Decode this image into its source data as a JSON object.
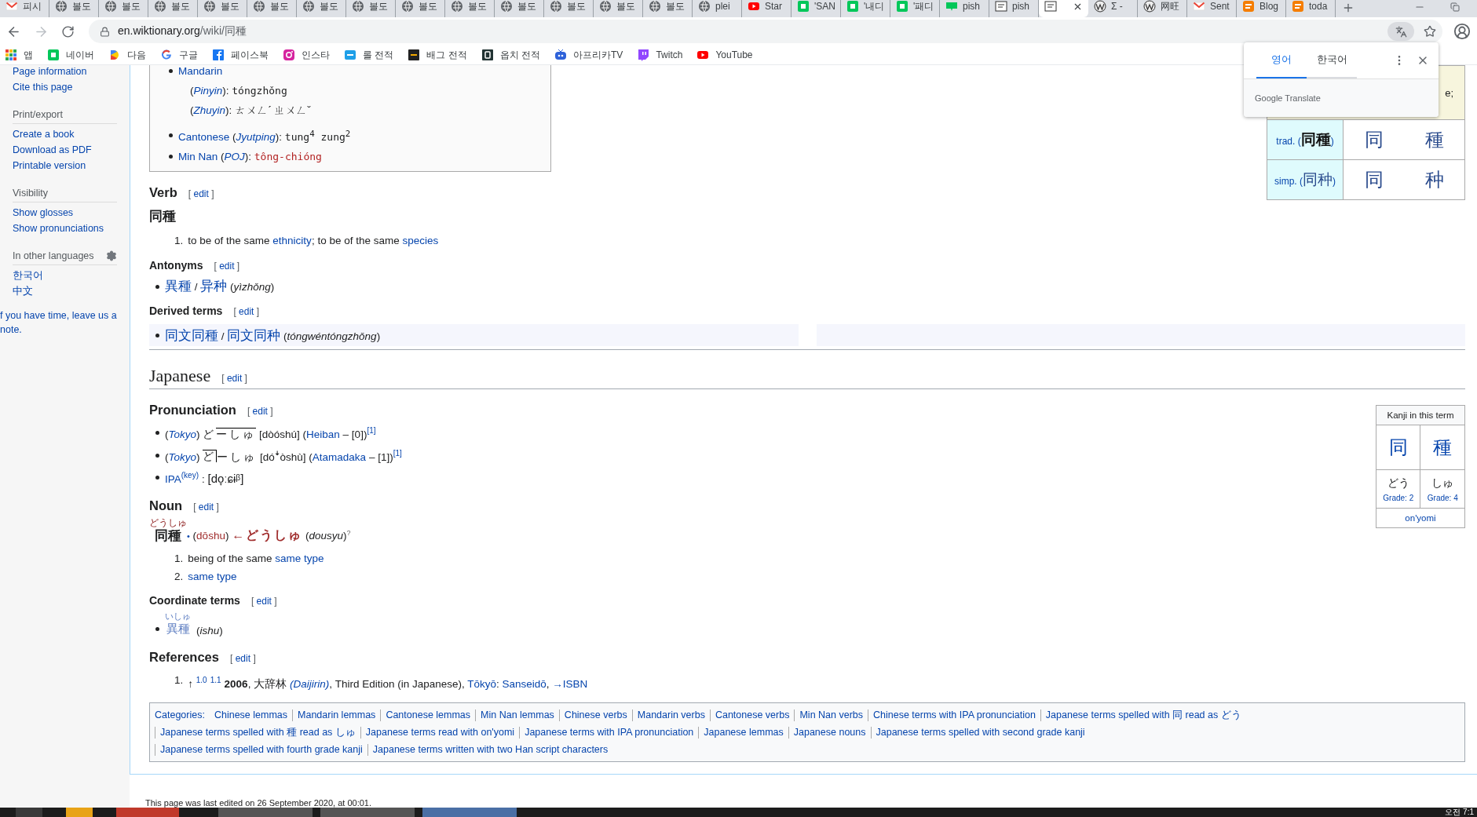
{
  "browser": {
    "tabs": [
      {
        "kind": "gmail",
        "title": "피시",
        "selected": false
      },
      {
        "kind": "globe",
        "title": "볼도",
        "selected": false
      },
      {
        "kind": "globe",
        "title": "볼도",
        "selected": false
      },
      {
        "kind": "globe",
        "title": "볼도",
        "selected": false
      },
      {
        "kind": "globe",
        "title": "볼도",
        "selected": false
      },
      {
        "kind": "globe",
        "title": "볼도",
        "selected": false
      },
      {
        "kind": "globe",
        "title": "볼도",
        "selected": false
      },
      {
        "kind": "globe",
        "title": "볼도",
        "selected": false
      },
      {
        "kind": "globe",
        "title": "볼도",
        "selected": false
      },
      {
        "kind": "globe",
        "title": "볼도",
        "selected": false
      },
      {
        "kind": "globe",
        "title": "볼도",
        "selected": false
      },
      {
        "kind": "globe",
        "title": "볼도",
        "selected": false
      },
      {
        "kind": "globe",
        "title": "볼도",
        "selected": false
      },
      {
        "kind": "globe",
        "title": "볼도",
        "selected": false
      },
      {
        "kind": "globe",
        "title": "plei",
        "selected": false
      },
      {
        "kind": "youtube",
        "title": "Star",
        "selected": false
      },
      {
        "kind": "naver",
        "title": "'SAN",
        "selected": false
      },
      {
        "kind": "naver",
        "title": "'내디",
        "selected": false
      },
      {
        "kind": "naver",
        "title": "'패디",
        "selected": false
      },
      {
        "kind": "blog",
        "title": "pish",
        "selected": false
      },
      {
        "kind": "wiki",
        "title": "pish",
        "selected": false
      },
      {
        "kind": "wiki",
        "selected": true
      },
      {
        "kind": "wikipedia",
        "title": "Σ -",
        "selected": false
      },
      {
        "kind": "wikipedia",
        "title": "网旺",
        "selected": false
      },
      {
        "kind": "gmail",
        "title": "Sent",
        "selected": false
      },
      {
        "kind": "blogger",
        "title": "Blog",
        "selected": false
      },
      {
        "kind": "blogger",
        "title": "toda",
        "selected": false
      }
    ],
    "address": {
      "host": "en.wiktionary.org",
      "path": "/wiki/同種"
    },
    "bookmarks": [
      {
        "kind": "apps",
        "label": "앱"
      },
      {
        "kind": "naver",
        "label": "네이버"
      },
      {
        "kind": "daum",
        "label": "다음"
      },
      {
        "kind": "google",
        "label": "구글"
      },
      {
        "kind": "facebook",
        "label": "페이스북"
      },
      {
        "kind": "instagram",
        "label": "인스타"
      },
      {
        "kind": "opgg",
        "label": "롤 전적"
      },
      {
        "kind": "pubg",
        "label": "배그 전적"
      },
      {
        "kind": "overwatch",
        "label": "옵치 전적"
      },
      {
        "kind": "afreeca",
        "label": "아프리카TV"
      },
      {
        "kind": "twitch",
        "label": "Twitch"
      },
      {
        "kind": "youtube",
        "label": "YouTube"
      }
    ]
  },
  "translate_popup": {
    "languages": [
      {
        "label": "영어",
        "selected": true
      },
      {
        "label": "한국어",
        "selected": false
      }
    ],
    "brand": "Google Translate"
  },
  "sidebar": {
    "sections": [
      {
        "kind": "links",
        "items": [
          "Page information",
          "Cite this page"
        ]
      },
      {
        "kind": "links",
        "heading": "Print/export",
        "items": [
          "Create a book",
          "Download as PDF",
          "Printable version"
        ]
      },
      {
        "kind": "links",
        "heading": "Visibility",
        "items": [
          "Show glosses",
          "Show pronunciations"
        ]
      },
      {
        "kind": "languages",
        "heading": "In other languages",
        "items": [
          "한국어",
          "中文"
        ]
      }
    ],
    "note": "f you have time, leave us a note."
  },
  "chinese": {
    "pronunciation_box": {
      "items": [
        {
          "segments": [
            {
              "kind": "link",
              "text": "Mandarin"
            }
          ],
          "children": [
            {
              "segments": [
                {
                  "kind": "plain",
                  "text": "("
                },
                {
                  "kind": "italic-link",
                  "text": "Pinyin"
                },
                {
                  "kind": "plain",
                  "text": "): "
                },
                {
                  "kind": "mono",
                  "text": "tóngzhǒng"
                }
              ]
            },
            {
              "segments": [
                {
                  "kind": "plain",
                  "text": "("
                },
                {
                  "kind": "italic-link",
                  "text": "Zhuyin"
                },
                {
                  "kind": "plain",
                  "text": "): "
                },
                {
                  "kind": "plain",
                  "text": "ㄊㄨㄥˊ ㄓㄨㄥˇ"
                }
              ]
            }
          ]
        },
        {
          "segments": [
            {
              "kind": "link",
              "text": "Cantonese"
            },
            {
              "kind": "plain",
              "text": " ("
            },
            {
              "kind": "italic-link",
              "text": "Jyutping"
            },
            {
              "kind": "plain",
              "text": "): "
            },
            {
              "kind": "mono",
              "text": "tung$^{4}$ zung$^{2}$"
            }
          ]
        },
        {
          "segments": [
            {
              "kind": "link",
              "text": "Min Nan"
            },
            {
              "kind": "plain",
              "text": " ("
            },
            {
              "kind": "italic-link",
              "text": "POJ"
            },
            {
              "kind": "plain",
              "text": "): "
            },
            {
              "kind": "mono-red",
              "text": "tông-chióng"
            }
          ]
        }
      ]
    },
    "forms_table": {
      "top_row": "e;",
      "rows": [
        {
          "kind": "trad",
          "label": "trad.",
          "open": "(",
          "form": "同種",
          "close": ")",
          "chars": [
            "同",
            "種"
          ]
        },
        {
          "kind": "simp",
          "label": "simp.",
          "open": "(",
          "form": "同种",
          "close": ")",
          "chars": [
            "同",
            "种"
          ]
        }
      ]
    },
    "verb": {
      "heading": "Verb",
      "edit": {
        "open": "[",
        "label": "edit",
        "close": "]"
      },
      "headword": "同種",
      "senses": [
        {
          "number": "1.",
          "segments": [
            {
              "kind": "plain",
              "text": "to be of the same "
            },
            {
              "kind": "link",
              "text": "ethnicity"
            },
            {
              "kind": "plain",
              "text": "; to be of the same "
            },
            {
              "kind": "link",
              "text": "species"
            }
          ]
        }
      ]
    },
    "antonyms": {
      "heading": "Antonyms",
      "edit": {
        "open": "[",
        "label": "edit",
        "close": "]"
      },
      "items": [
        [
          {
            "kind": "cjk-link",
            "text": "異種"
          },
          {
            "kind": "plain",
            "text": " / "
          },
          {
            "kind": "cjk-link",
            "text": "异种"
          },
          {
            "kind": "plain",
            "text": " ("
          },
          {
            "kind": "italic",
            "text": "yìzhǒng"
          },
          {
            "kind": "plain",
            "text": ")"
          }
        ]
      ]
    },
    "derived_terms": {
      "heading": "Derived terms",
      "edit": {
        "open": "[",
        "label": "edit",
        "close": "]"
      },
      "items": [
        [
          {
            "kind": "cjk-link",
            "text": "同文同種"
          },
          {
            "kind": "plain",
            "text": " / "
          },
          {
            "kind": "cjk-link",
            "text": "同文同种"
          },
          {
            "kind": "plain",
            "text": " ("
          },
          {
            "kind": "italic",
            "text": "tóngwéntóngzhǒng"
          },
          {
            "kind": "plain",
            "text": ")"
          }
        ]
      ]
    }
  },
  "japanese": {
    "heading": "Japanese",
    "edit": {
      "open": "[",
      "label": "edit",
      "close": "]"
    },
    "kanji_box": {
      "title": "Kanji in this term",
      "kanji": [
        {
          "char": "同",
          "reading": "どう",
          "grade": "Grade: 2"
        },
        {
          "char": "種",
          "reading": "しゅ",
          "grade": "Grade: 4"
        }
      ],
      "footer": "on'yomi"
    },
    "pronunciation": {
      "heading": "Pronunciation",
      "edit": {
        "open": "[",
        "label": "edit",
        "close": "]"
      },
      "items": [
        [
          {
            "kind": "plain",
            "text": "("
          },
          {
            "kind": "italic-link",
            "text": "Tokyo"
          },
          {
            "kind": "plain",
            "text": ") "
          },
          {
            "kind": "kana",
            "text": "ど"
          },
          {
            "kind": "kana-high",
            "text": "ーしゅ"
          },
          {
            "kind": "plain",
            "text": " [dòóshú] ("
          },
          {
            "kind": "link",
            "text": "Heiban"
          },
          {
            "kind": "plain",
            "text": " – [0])"
          },
          {
            "kind": "sup-link",
            "text": "[1]"
          }
        ],
        [
          {
            "kind": "plain",
            "text": "("
          },
          {
            "kind": "italic-link",
            "text": "Tokyo"
          },
          {
            "kind": "plain",
            "text": ") "
          },
          {
            "kind": "kana-high-drop",
            "text": "ど"
          },
          {
            "kind": "kana",
            "text": "ーしゅ"
          },
          {
            "kind": "plain",
            "text": " [dóꜜòshù] ("
          },
          {
            "kind": "link",
            "text": "Atamadaka"
          },
          {
            "kind": "plain",
            "text": " – [1])"
          },
          {
            "kind": "sup-link",
            "text": "[1]"
          }
        ],
        [
          {
            "kind": "link",
            "text": "IPA"
          },
          {
            "kind": "sup-link",
            "text": "(key)"
          },
          {
            "kind": "plain",
            "text": ": "
          },
          {
            "kind": "ipa",
            "text": "[do̞ːɕɨᵝ]"
          }
        ]
      ]
    },
    "noun": {
      "heading": "Noun",
      "edit": {
        "open": "[",
        "label": "edit",
        "close": "]"
      },
      "headword": "同種",
      "ruby": "どうしゅ",
      "segments": [
        {
          "kind": "blue",
          "text": " •"
        },
        {
          "kind": "plain",
          "text": " ("
        },
        {
          "kind": "red",
          "text": "dōshu"
        },
        {
          "kind": "plain",
          "text": ") "
        },
        {
          "kind": "red-bold",
          "text": "←どうしゅ"
        },
        {
          "kind": "plain",
          "text": " ("
        },
        {
          "kind": "italic",
          "text": "dousyu"
        },
        {
          "kind": "plain",
          "text": ")"
        },
        {
          "kind": "sup",
          "text": "?"
        }
      ],
      "senses": [
        {
          "number": "1.",
          "segments": [
            {
              "kind": "plain",
              "text": "being of the same "
            },
            {
              "kind": "link",
              "text": "same type"
            }
          ]
        },
        {
          "number": "2.",
          "segments": [
            {
              "kind": "link",
              "text": "same type"
            }
          ]
        }
      ]
    },
    "coordinate_terms": {
      "heading": "Coordinate terms",
      "edit": {
        "open": "[",
        "label": "edit",
        "close": "]"
      },
      "items": [
        {
          "ruby": "いしゅ",
          "term": "異種",
          "segments": [
            {
              "kind": "plain",
              "text": " ("
            },
            {
              "kind": "italic",
              "text": "ishu"
            },
            {
              "kind": "plain",
              "text": ")"
            }
          ]
        }
      ]
    },
    "references": {
      "heading": "References",
      "edit": {
        "open": "[",
        "label": "edit",
        "close": "]"
      },
      "items": [
        {
          "number": "1.",
          "segments": [
            {
              "kind": "plain",
              "text": "↑ "
            },
            {
              "kind": "sup-link",
              "text": "1.0"
            },
            {
              "kind": "sup-link",
              "text": "1.1"
            },
            {
              "kind": "bold",
              "text": "2006"
            },
            {
              "kind": "plain",
              "text": ", 大辞林 "
            },
            {
              "kind": "italic-link",
              "text": "(Daijirin)"
            },
            {
              "kind": "plain",
              "text": ", Third Edition (in Japanese), "
            },
            {
              "kind": "link",
              "text": "Tōkyō"
            },
            {
              "kind": "plain",
              "text": ": "
            },
            {
              "kind": "link",
              "text": "Sanseidō"
            },
            {
              "kind": "plain",
              "text": ", "
            },
            {
              "kind": "link",
              "text": "→ISBN"
            }
          ]
        }
      ]
    }
  },
  "categories": {
    "label": "Categories:",
    "items": [
      "Chinese lemmas",
      "Mandarin lemmas",
      "Cantonese lemmas",
      "Min Nan lemmas",
      "Chinese verbs",
      "Mandarin verbs",
      "Cantonese verbs",
      "Min Nan verbs",
      "Chinese terms with IPA pronunciation",
      "Japanese terms spelled with 同 read as どう",
      "Japanese terms spelled with 種 read as しゅ",
      "Japanese terms read with on'yomi",
      "Japanese terms with IPA pronunciation",
      "Japanese lemmas",
      "Japanese nouns",
      "Japanese terms spelled with second grade kanji",
      "Japanese terms spelled with fourth grade kanji",
      "Japanese terms written with two Han script characters"
    ]
  },
  "footer": "This page was last edited on 26 September 2020, at 00:01.",
  "taskbar": {
    "clock": "오전 7:1"
  }
}
